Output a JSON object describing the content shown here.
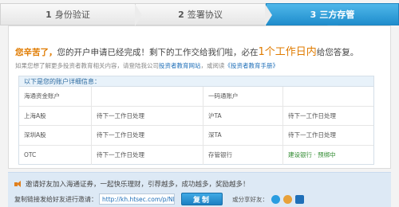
{
  "steps": [
    {
      "num": "1",
      "label": "身份验证"
    },
    {
      "num": "2",
      "label": "签署协议"
    },
    {
      "num": "3",
      "label": "三方存管"
    }
  ],
  "greeting": {
    "hello": "您辛苦了，",
    "text1": "您的开户申请已经完成！剩下的工作交给我们啦，必在",
    "big": "1个工作日内",
    "text2": "给您答复。"
  },
  "note": {
    "text1": "如果您想了解更多投资者教育相关内容，请登陆我公司",
    "link1": "投资者教育网站",
    "text2": "，或阅读",
    "link2": "《投资者教育手册》"
  },
  "account_card": {
    "header": "以下是您的账户详细信息：",
    "rows": [
      [
        "海通资金账户",
        "",
        "一码通账户",
        ""
      ],
      [
        "上海A股",
        "待下一工作日处理",
        "沪TA",
        "待下一工作日处理"
      ],
      [
        "深圳A股",
        "待下一工作日处理",
        "深TA",
        "待下一工作日处理"
      ],
      [
        "OTC",
        "待下一工作日处理",
        "存管银行",
        "建设银行 · 预绑中"
      ]
    ]
  },
  "invite": {
    "line1": "邀请好友加入海通证券，一起快乐理财，引荐越多，成功越多，奖励越多！",
    "line2_label": "复制链接发给好友进行邀请：",
    "url": "http://kh.htsec.com/p/NBV3Mf",
    "copy_label": "复制",
    "share_label": "或分享好友："
  },
  "colors": {
    "active_step": "#1f8dcc",
    "highlight": "#e07b00",
    "link": "#1f6fb8"
  }
}
